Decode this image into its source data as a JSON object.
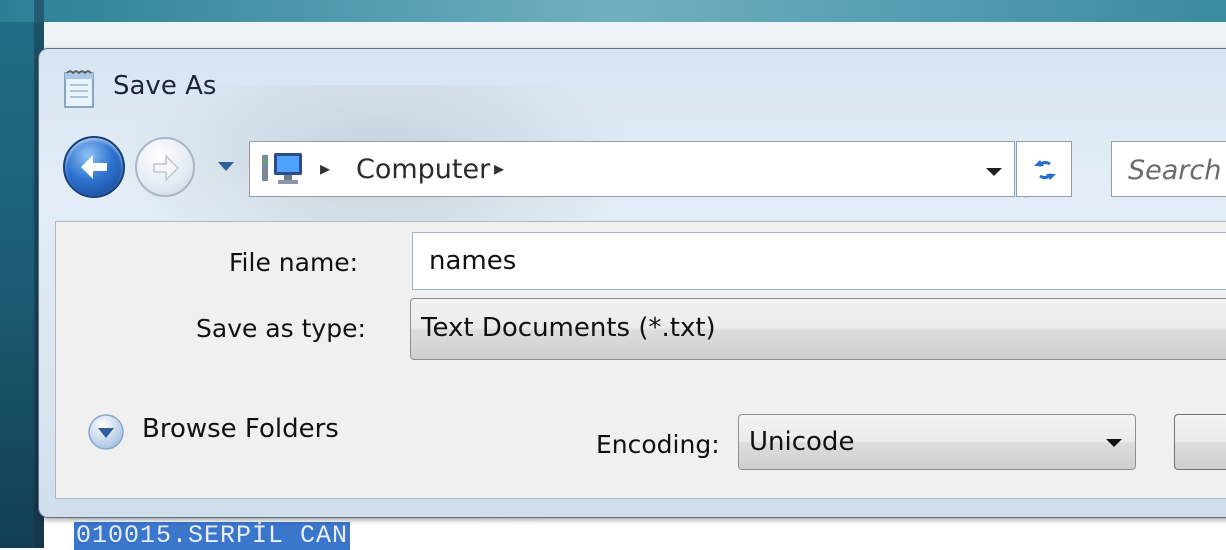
{
  "dialog": {
    "title": "Save As",
    "icon": "notepad-icon"
  },
  "nav": {
    "back_icon": "back-arrow-icon",
    "forward_icon": "forward-arrow-icon",
    "history_icon": "chevron-down-icon",
    "address": {
      "location_icon": "computer-icon",
      "breadcrumb": [
        "Computer"
      ],
      "dropdown_icon": "chevron-down-icon"
    },
    "refresh_icon": "refresh-icon",
    "search": {
      "placeholder": "Search"
    }
  },
  "form": {
    "file_name_label": "File name:",
    "file_name_value": "names",
    "save_type_label": "Save as type:",
    "save_type_value": "Text Documents (*.txt)",
    "browse_folders_label": "Browse Folders",
    "encoding_label": "Encoding:",
    "encoding_value": "Unicode"
  },
  "background": {
    "selected_text": "010015.SERPİL CAN"
  },
  "colors": {
    "accent": "#2f74d0",
    "selection": "#3a76cc"
  }
}
